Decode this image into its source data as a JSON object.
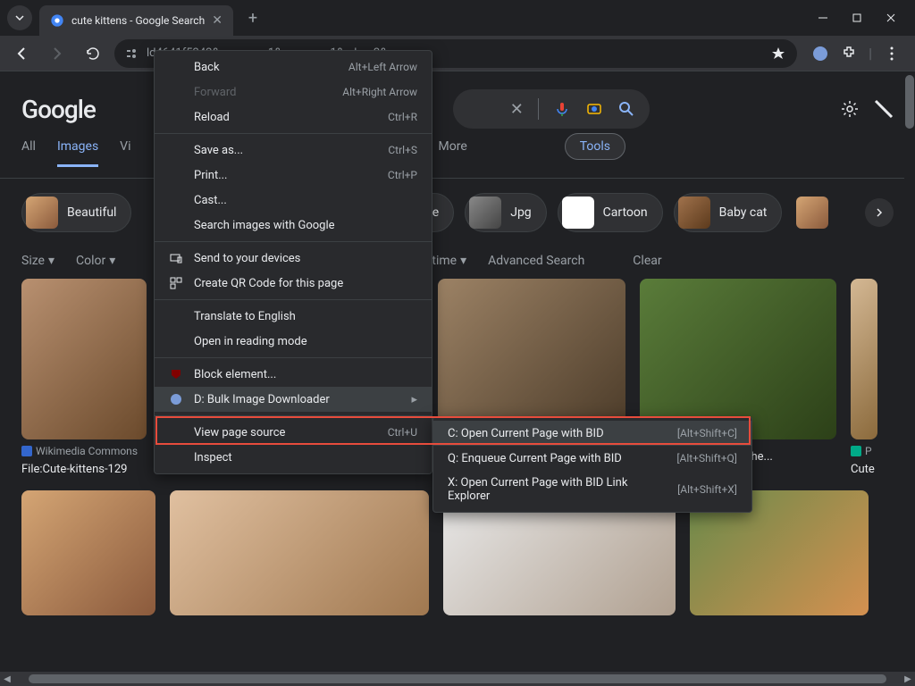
{
  "titlebar": {
    "tab_title": "cute kittens - Google Search"
  },
  "toolbar": {
    "url_text": "ld4641f5242&sca_upv=1&sca_upv=1&udm=2&s..."
  },
  "page": {
    "logo": "Google",
    "tabs": {
      "all": "All",
      "images": "Images",
      "videos_partial": "Vi",
      "more": "More",
      "tools": "Tools"
    },
    "chips": [
      {
        "label": "Beautiful"
      },
      {
        "label_partial": "ce"
      },
      {
        "label": "Jpg"
      },
      {
        "label": "Cartoon"
      },
      {
        "label": "Baby cat"
      }
    ],
    "filters": {
      "size": "Size",
      "color": "Color",
      "time_partial": "y time",
      "advanced": "Advanced Search",
      "clear": "Clear"
    },
    "results": [
      {
        "source": "Wikimedia Commons",
        "title": "File:Cute-kittens-129"
      },
      {
        "title_partial": "...the cutest kitten in the..."
      },
      {
        "source_partial": "P",
        "title": "Cute"
      }
    ]
  },
  "context_menu": {
    "back": {
      "label": "Back",
      "shortcut": "Alt+Left Arrow"
    },
    "forward": {
      "label": "Forward",
      "shortcut": "Alt+Right Arrow"
    },
    "reload": {
      "label": "Reload",
      "shortcut": "Ctrl+R"
    },
    "save_as": {
      "label": "Save as...",
      "shortcut": "Ctrl+S"
    },
    "print": {
      "label": "Print...",
      "shortcut": "Ctrl+P"
    },
    "cast": {
      "label": "Cast..."
    },
    "search_images": {
      "label": "Search images with Google"
    },
    "send_devices": {
      "label": "Send to your devices"
    },
    "qr_code": {
      "label": "Create QR Code for this page"
    },
    "translate": {
      "label": "Translate to English"
    },
    "reading_mode": {
      "label": "Open in reading mode"
    },
    "block_element": {
      "label": "Block element..."
    },
    "bid": {
      "label": "D: Bulk Image Downloader"
    },
    "view_source": {
      "label": "View page source",
      "shortcut": "Ctrl+U"
    },
    "inspect": {
      "label": "Inspect"
    }
  },
  "submenu": {
    "open_current": {
      "label": "C: Open Current Page with BID",
      "shortcut": "[Alt+Shift+C]"
    },
    "enqueue": {
      "label": "Q: Enqueue Current Page with BID",
      "shortcut": "[Alt+Shift+Q]"
    },
    "link_explorer": {
      "label": "X: Open Current Page with BID Link Explorer",
      "shortcut": "[Alt+Shift+X]"
    }
  }
}
